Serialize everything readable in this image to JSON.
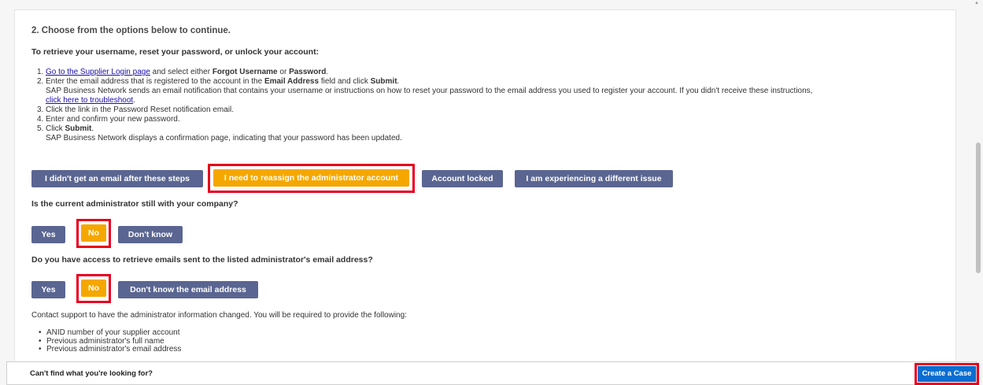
{
  "heading": "2. Choose from the options below to continue.",
  "subheading": "To retrieve your username, reset your password, or unlock your account:",
  "steps": {
    "s1": {
      "num": "1.",
      "link": "Go to the Supplier Login page",
      "text_a": " and select either ",
      "bold_a": "Forgot Username",
      "text_b": " or ",
      "bold_b": "Password",
      "text_c": "."
    },
    "s2": {
      "num": "2.",
      "text_a": "Enter the email address that is registered to the account in the ",
      "bold_a": "Email Address",
      "text_b": " field and click ",
      "bold_b": "Submit",
      "text_c": ".",
      "cont": "SAP Business Network sends an email notification that contains your username or instructions on how to reset your password to the email address you used to register your account. If you didn't receive these instructions,",
      "link": "click here to troubleshoot",
      "link_after": "."
    },
    "s3": {
      "num": "3.",
      "text": "Click the link in the Password Reset notification email."
    },
    "s4": {
      "num": "4.",
      "text": "Enter and confirm your new password."
    },
    "s5": {
      "num": "5.",
      "text_a": "Click ",
      "bold_a": "Submit",
      "text_b": ".",
      "cont": "SAP Business Network displays a confirmation page, indicating that your password has been updated."
    }
  },
  "issue_buttons": {
    "no_email": "I didn't get an email after these steps",
    "reassign": "I need to reassign the administrator account",
    "locked": "Account locked",
    "different": "I am experiencing a different issue"
  },
  "q1": {
    "text": "Is the current administrator still with your company?",
    "yes": "Yes",
    "no": "No",
    "dont_know": "Don't know"
  },
  "q2": {
    "text": "Do you have access to retrieve emails sent to the listed administrator's email address?",
    "yes": "Yes",
    "no": "No",
    "dont_know": "Don't know the email address"
  },
  "note": "Contact support to have the administrator information changed. You will be required to provide the following:",
  "bullets": [
    "ANID number of your supplier account",
    "Previous administrator's full name",
    "Previous administrator's email address"
  ],
  "bullet_glyph": "•",
  "footer": {
    "text": "Can't find what you're looking for?",
    "button": "Create a Case"
  },
  "scroll_up_glyph": "▲",
  "colors": {
    "button": "#5a6691",
    "selected": "#f5a700",
    "highlight": "#e8001c",
    "case_button": "#0a6ed1",
    "link": "#1a0dab"
  }
}
